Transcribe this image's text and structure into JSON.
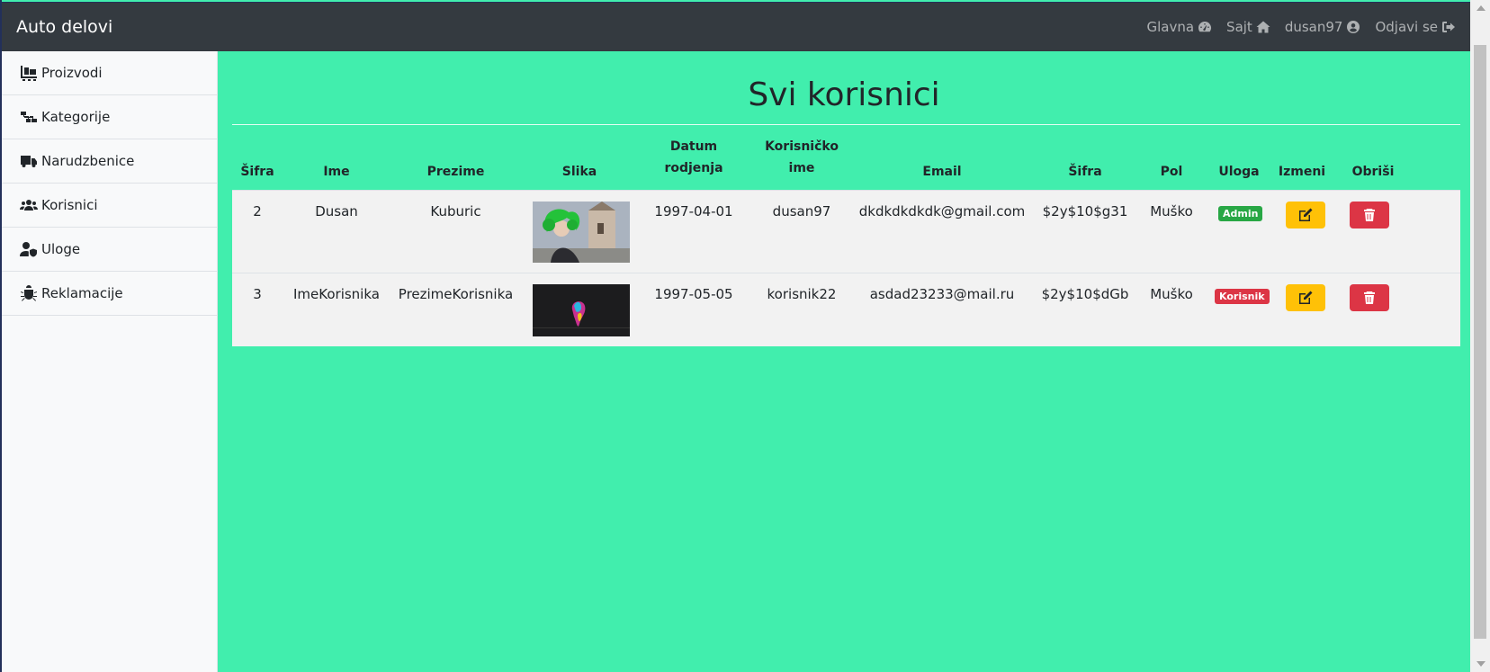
{
  "brand": "Auto delovi",
  "nav": [
    {
      "label": "Glavna",
      "icon": "tachometer-icon"
    },
    {
      "label": "Sajt",
      "icon": "home-icon"
    },
    {
      "label": "dusan97",
      "icon": "user-circle-icon"
    },
    {
      "label": "Odjavi se",
      "icon": "sign-out-icon"
    }
  ],
  "sidebar": {
    "items": [
      {
        "label": "Proizvodi",
        "icon": "pallet-icon"
      },
      {
        "label": "Kategorije",
        "icon": "sitemap-icon"
      },
      {
        "label": "Narudzbenice",
        "icon": "truck-icon"
      },
      {
        "label": "Korisnici",
        "icon": "users-icon"
      },
      {
        "label": "Uloge",
        "icon": "user-shield-icon"
      },
      {
        "label": "Reklamacije",
        "icon": "bug-icon"
      }
    ]
  },
  "page_title": "Svi korisnici",
  "table": {
    "headers": {
      "id": "Šifra",
      "first": "Ime",
      "last": "Prezime",
      "image": "Slika",
      "dob_1": "Datum",
      "dob_2": "rodjenja",
      "username_1": "Korisničko",
      "username_2": "ime",
      "email": "Email",
      "password": "Šifra",
      "gender": "Pol",
      "role": "Uloga",
      "edit": "Izmeni",
      "delete": "Obriši"
    },
    "rows": [
      {
        "id": "2",
        "first": "Dusan",
        "last": "Kuburic",
        "dob": "1997-04-01",
        "username": "dusan97",
        "email": "dkdkdkdkdk@gmail.com",
        "password": "$2y$10$g31",
        "gender": "Muško",
        "role": "Admin",
        "role_color": "#28a745"
      },
      {
        "id": "3",
        "first": "ImeKorisnika",
        "last": "PrezimeKorisnika",
        "dob": "1997-05-05",
        "username": "korisnik22",
        "email": "asdad23233@mail.ru",
        "password": "$2y$10$dGb",
        "gender": "Muško",
        "role": "Korisnik",
        "role_color": "#dc3545"
      }
    ]
  },
  "colors": {
    "background": "#41eead",
    "navbar": "#343a40",
    "edit_button": "#ffc107",
    "delete_button": "#dc3545"
  }
}
